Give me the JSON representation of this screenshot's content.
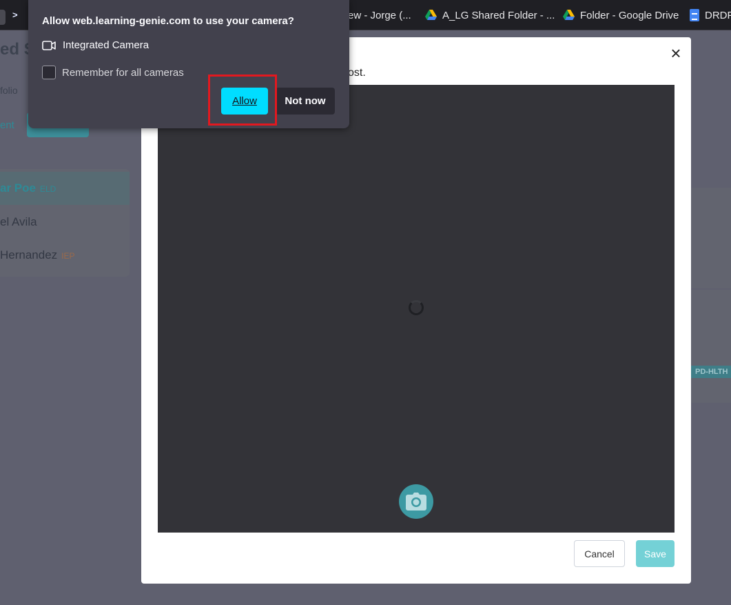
{
  "bookmarks": {
    "items": [
      {
        "label": "ew - Jorge (...",
        "icon": "doc-icon"
      },
      {
        "label": "A_LG Shared Folder - ...",
        "icon": "google-drive-icon"
      },
      {
        "label": "Folder - Google Drive",
        "icon": "google-drive-icon"
      },
      {
        "label": "DRDP",
        "icon": "google-docs-icon"
      }
    ]
  },
  "background": {
    "title": "ed S",
    "portfolio": "folio",
    "tab": "ent",
    "students": [
      {
        "name": "ar Poe",
        "tag": "ELD",
        "tag_color": "#2e8a96"
      },
      {
        "name": "el Avila",
        "tag": ""
      },
      {
        "name": "Hernandez",
        "tag": "IEP",
        "tag_color": "#9c6a4a"
      }
    ],
    "badge": "PD-HLTH"
  },
  "modal": {
    "close": "×",
    "instruction": "ost.",
    "cancel_label": "Cancel",
    "save_label": "Save"
  },
  "permission": {
    "title": "Allow web.learning-genie.com to use your camera?",
    "camera_name": "Integrated Camera",
    "remember_label": "Remember for all cameras",
    "allow_label": "Allow",
    "not_now_label": "Not now",
    "remember_checked": false
  },
  "colors": {
    "allow_button": "#00ddff",
    "highlight_box": "#e3181f",
    "save_button": "#74d1d6",
    "shutter": "#3d9aa3"
  }
}
